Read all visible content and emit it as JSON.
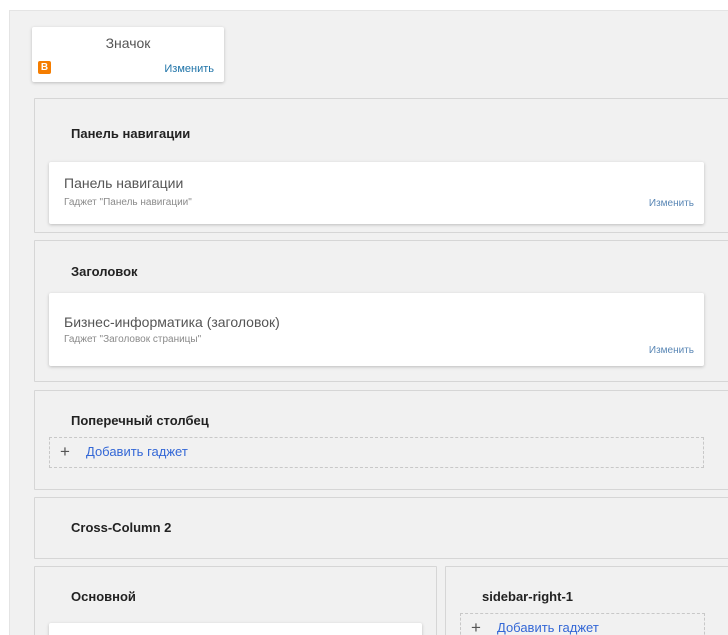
{
  "favicon": {
    "title": "Значок",
    "edit_label": "Изменить",
    "icon_glyph": "B",
    "icon_color": "#f57d00"
  },
  "sections": {
    "navbar": {
      "title": "Панель навигации",
      "widget": {
        "title": "Панель навигации",
        "subtitle": "Гаджет \"Панель навигации\"",
        "edit_label": "Изменить"
      }
    },
    "header": {
      "title": "Заголовок",
      "widget": {
        "title": "Бизнес-информатика (заголовок)",
        "subtitle": "Гаджет \"Заголовок страницы\"",
        "edit_label": "Изменить"
      }
    },
    "cross_column": {
      "title": "Поперечный столбец",
      "add_icon": "+",
      "add_label": "Добавить гаджет"
    },
    "cross_column_2": {
      "title": "Cross-Column 2"
    },
    "main": {
      "title": "Основной"
    },
    "sidebar_right_1": {
      "title": "sidebar-right-1",
      "add_icon": "+",
      "add_label": "Добавить гаджет"
    }
  },
  "colors": {
    "link": "#1e73a8",
    "add_link": "#3367d6",
    "canvas": "#f1f1f1"
  }
}
